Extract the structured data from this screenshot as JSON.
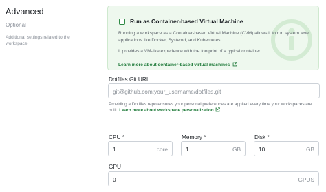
{
  "section": {
    "title": "Advanced",
    "optional": "Optional",
    "description": "Additional settings related to the workspace."
  },
  "cvm": {
    "label": "Run as Container-based Virtual Machine",
    "checked": false,
    "desc1": "Running a workspace as a Container-based Virtual Machine (CVM) allows it to run system level applications like Docker, Systemd, and Kubernetes.",
    "desc2": "It provides a VM-like experience with the footprint of a typical container.",
    "link": "Learn more about container-based virtual machines",
    "accent_color": "#2f8a45",
    "background_color": "#eef8ee"
  },
  "dotfiles": {
    "label": "Dotfiles Git URI",
    "placeholder": "git@github.com:your_username/dotfiles.git",
    "helper_text": "Providing a Dotfiles repo ensures your personal preferences are applied every time your workspaces are built.",
    "helper_link": "Learn more about workspace personalization"
  },
  "resources": {
    "cpu": {
      "label": "CPU",
      "required_mark": "*",
      "value": "1",
      "unit": "core"
    },
    "memory": {
      "label": "Memory",
      "required_mark": "*",
      "value": "1",
      "unit": "GB"
    },
    "disk": {
      "label": "Disk",
      "required_mark": "*",
      "value": "10",
      "unit": "GB"
    },
    "gpu": {
      "label": "GPU",
      "value": "0",
      "unit": "GPUS"
    }
  },
  "icons": [
    "info-icon",
    "external-link-icon"
  ]
}
